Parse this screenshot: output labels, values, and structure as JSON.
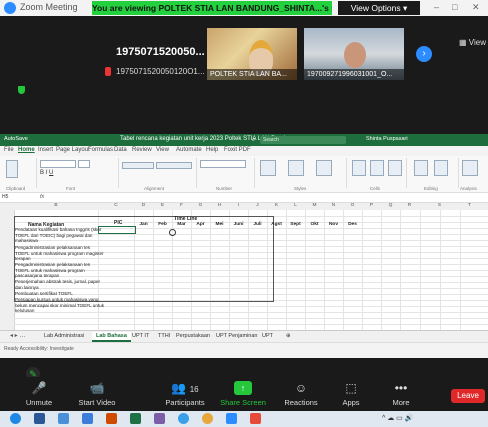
{
  "zoom": {
    "window_title": "Zoom Meeting",
    "share_banner": "You are viewing POLTEK STIA LAN BANDUNG_SHINTA...'s screen",
    "view_options": "View Options",
    "view_label": "View",
    "window_controls": [
      "–",
      "□",
      "✕"
    ]
  },
  "participants_top": {
    "name_large": "1975071520050...",
    "name_full": "1975071520050120O1...",
    "tiles": [
      {
        "label": "POLTEK STIA LAN BA..."
      },
      {
        "label": "197009271996031001_O..."
      }
    ]
  },
  "excel": {
    "title": "Tabel rencana kegiatan unit kerja 2023 Poltek STIA LAN Bandung",
    "autosave": "AutoSave",
    "search_placeholder": "Search",
    "user": "Shinta Puspasari",
    "tabs": [
      "File",
      "Home",
      "Insert",
      "Page Layout",
      "Formulas",
      "Data",
      "Review",
      "View",
      "Automate",
      "Help",
      "Foxit PDF"
    ],
    "ribbon_groups": [
      "Clipboard",
      "Font",
      "Alignment",
      "Number",
      "Styles",
      "Cells",
      "Editing",
      "Analysis"
    ],
    "name_box": "H5",
    "formula_symbol": "fx",
    "columns": [
      "A",
      "B",
      "C",
      "D",
      "E",
      "F",
      "G",
      "H",
      "I",
      "J",
      "K",
      "L",
      "M",
      "N",
      "O",
      "P",
      "Q",
      "R",
      "S",
      "T"
    ],
    "table": {
      "header_kegiatan": "Nama Kegiatan",
      "header_pic": "PIC",
      "header_timeline": "Time Line",
      "months": [
        "Jan",
        "Feb",
        "Mar",
        "Apr",
        "Mei",
        "Juni",
        "Juli",
        "Agst",
        "Sept",
        "Okt",
        "Nov",
        "Des"
      ],
      "tasks": [
        "Pendataan kualifikasi bahasa Inggris (skor TOEFL dan TOEIC) bagi pegawai dan mahasiswa",
        "Pengadministrasian pelaksanaan tes TOEFL untuk mahasiswa program magister terapan",
        "Pengadministrasian pelaksanaan tes TOEFL untuk mahasiswa program pascasarjana terapan",
        "Penerjemahan abstrak tesis, jurnal, paper dan lainnya",
        "Pembuatan sertifikat TOEFL",
        "Persiapan kursus untuk mahasiswa yang belum mencapai skor minimal TOEFL untuk kelulusan"
      ]
    },
    "sheet_tabs": [
      "Lab Administrasi",
      "Lab Bahasa",
      "UPT IT",
      "TTHI",
      "Perpustakaan",
      "UPT Penjaminan",
      "UPT"
    ],
    "active_sheet": "Lab Bahasa",
    "status": "Ready   Accessibility: Investigate"
  },
  "toolbar": {
    "items": [
      {
        "label": "Unmute",
        "icon": "🎤"
      },
      {
        "label": "Start Video",
        "icon": "📹"
      },
      {
        "label": "Participants",
        "icon": "👥",
        "count": "16"
      },
      {
        "label": "Share Screen",
        "icon": "↑"
      },
      {
        "label": "Reactions",
        "icon": "☺"
      },
      {
        "label": "Apps",
        "icon": "⬚"
      },
      {
        "label": "More",
        "icon": "•••"
      }
    ],
    "leave_label": "Leave"
  },
  "colors": {
    "banner_green": "#23d13e",
    "excel_green": "#1e6e3d",
    "leave_red": "#e02828",
    "zoom_blue": "#2d8cff"
  }
}
